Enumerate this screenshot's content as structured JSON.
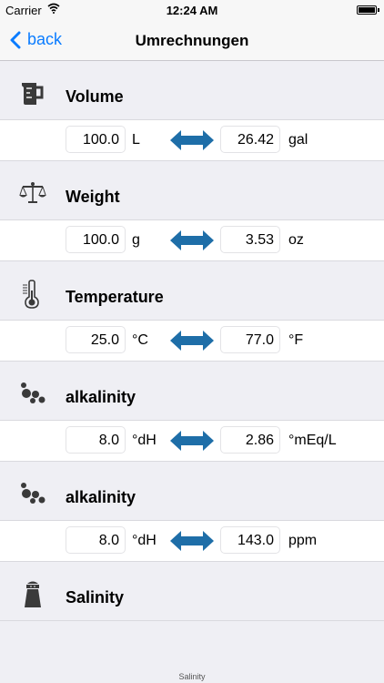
{
  "status": {
    "carrier": "Carrier",
    "time": "12:24 AM"
  },
  "nav": {
    "back_label": "back",
    "title": "Umrechnungen"
  },
  "sections": [
    {
      "label": "Volume",
      "icon": "measuring-cup-icon",
      "left_value": "100.0",
      "left_unit": "L",
      "right_value": "26.42",
      "right_unit": "gal"
    },
    {
      "label": "Weight",
      "icon": "scale-icon",
      "left_value": "100.0",
      "left_unit": "g",
      "right_value": "3.53",
      "right_unit": "oz"
    },
    {
      "label": "Temperature",
      "icon": "thermometer-icon",
      "left_value": "25.0",
      "left_unit": "°C",
      "right_value": "77.0",
      "right_unit": "°F"
    },
    {
      "label": "alkalinity",
      "icon": "bubbles-icon",
      "left_value": "8.0",
      "left_unit": "°dH",
      "right_value": "2.86",
      "right_unit": "°mEq/L"
    },
    {
      "label": "alkalinity",
      "icon": "bubbles-icon",
      "left_value": "8.0",
      "left_unit": "°dH",
      "right_value": "143.0",
      "right_unit": "ppm"
    },
    {
      "label": "Salinity",
      "icon": "salt-shaker-icon"
    }
  ],
  "footer_label": "Salinity",
  "colors": {
    "accent": "#0a7cff",
    "arrow": "#1e6ea8",
    "icon": "#3a3a3a"
  }
}
